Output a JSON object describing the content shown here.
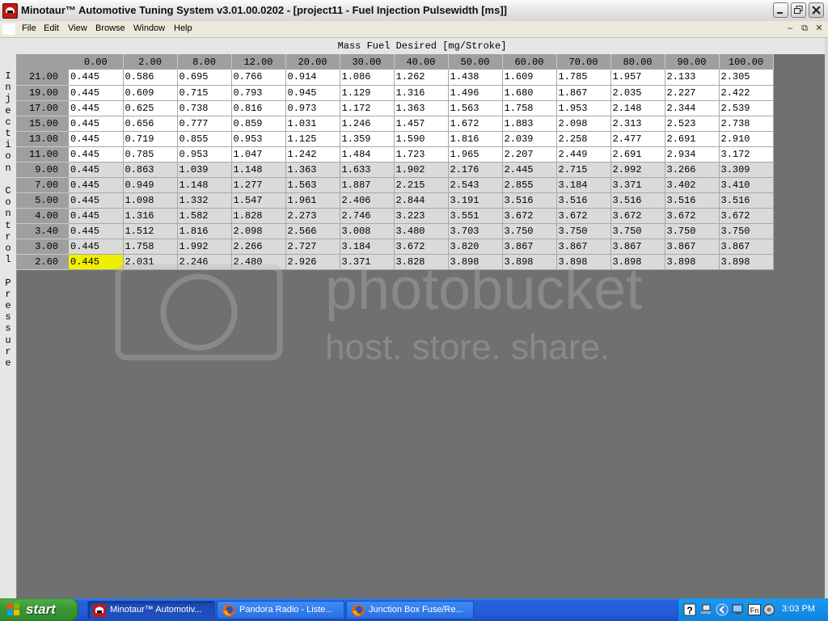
{
  "window": {
    "title": "Minotaur™ Automotive Tuning System  v3.01.00.0202 - [project11 - Fuel Injection Pulsewidth [ms]]"
  },
  "menubar": {
    "items": [
      "File",
      "Edit",
      "View",
      "Browse",
      "Window",
      "Help"
    ]
  },
  "table": {
    "column_axis_title": "Mass Fuel Desired [mg/Stroke]",
    "row_axis_title": "Injection Control Pressure",
    "columns": [
      "0.00",
      "2.00",
      "8.00",
      "12.00",
      "20.00",
      "30.00",
      "40.00",
      "50.00",
      "60.00",
      "70.00",
      "80.00",
      "90.00",
      "100.00"
    ],
    "rows": [
      {
        "label": "21.00",
        "values": [
          "0.445",
          "0.586",
          "0.695",
          "0.766",
          "0.914",
          "1.086",
          "1.262",
          "1.438",
          "1.609",
          "1.785",
          "1.957",
          "2.133",
          "2.305"
        ]
      },
      {
        "label": "19.00",
        "values": [
          "0.445",
          "0.609",
          "0.715",
          "0.793",
          "0.945",
          "1.129",
          "1.316",
          "1.496",
          "1.680",
          "1.867",
          "2.035",
          "2.227",
          "2.422"
        ]
      },
      {
        "label": "17.00",
        "values": [
          "0.445",
          "0.625",
          "0.738",
          "0.816",
          "0.973",
          "1.172",
          "1.363",
          "1.563",
          "1.758",
          "1.953",
          "2.148",
          "2.344",
          "2.539"
        ]
      },
      {
        "label": "15.00",
        "values": [
          "0.445",
          "0.656",
          "0.777",
          "0.859",
          "1.031",
          "1.246",
          "1.457",
          "1.672",
          "1.883",
          "2.098",
          "2.313",
          "2.523",
          "2.738"
        ]
      },
      {
        "label": "13.00",
        "values": [
          "0.445",
          "0.719",
          "0.855",
          "0.953",
          "1.125",
          "1.359",
          "1.590",
          "1.816",
          "2.039",
          "2.258",
          "2.477",
          "2.691",
          "2.910"
        ]
      },
      {
        "label": "11.00",
        "values": [
          "0.445",
          "0.785",
          "0.953",
          "1.047",
          "1.242",
          "1.484",
          "1.723",
          "1.965",
          "2.207",
          "2.449",
          "2.691",
          "2.934",
          "3.172"
        ]
      },
      {
        "label": "9.00",
        "values": [
          "0.445",
          "0.863",
          "1.039",
          "1.148",
          "1.363",
          "1.633",
          "1.902",
          "2.176",
          "2.445",
          "2.715",
          "2.992",
          "3.266",
          "3.309"
        ]
      },
      {
        "label": "7.00",
        "values": [
          "0.445",
          "0.949",
          "1.148",
          "1.277",
          "1.563",
          "1.887",
          "2.215",
          "2.543",
          "2.855",
          "3.184",
          "3.371",
          "3.402",
          "3.410"
        ]
      },
      {
        "label": "5.00",
        "values": [
          "0.445",
          "1.098",
          "1.332",
          "1.547",
          "1.961",
          "2.406",
          "2.844",
          "3.191",
          "3.516",
          "3.516",
          "3.516",
          "3.516",
          "3.516"
        ]
      },
      {
        "label": "4.00",
        "values": [
          "0.445",
          "1.316",
          "1.582",
          "1.828",
          "2.273",
          "2.746",
          "3.223",
          "3.551",
          "3.672",
          "3.672",
          "3.672",
          "3.672",
          "3.672"
        ]
      },
      {
        "label": "3.40",
        "values": [
          "0.445",
          "1.512",
          "1.816",
          "2.098",
          "2.566",
          "3.008",
          "3.480",
          "3.703",
          "3.750",
          "3.750",
          "3.750",
          "3.750",
          "3.750"
        ]
      },
      {
        "label": "3.00",
        "values": [
          "0.445",
          "1.758",
          "1.992",
          "2.266",
          "2.727",
          "3.184",
          "3.672",
          "3.820",
          "3.867",
          "3.867",
          "3.867",
          "3.867",
          "3.867"
        ]
      },
      {
        "label": "2.60",
        "values": [
          "0.445",
          "2.031",
          "2.246",
          "2.480",
          "2.926",
          "3.371",
          "3.828",
          "3.898",
          "3.898",
          "3.898",
          "3.898",
          "3.898",
          "3.898"
        ]
      }
    ],
    "white_row_count": 6,
    "selected_cell": {
      "row": 12,
      "col": 0
    },
    "colors": {
      "selected": "#f0ef00",
      "header": "#9f9f9f",
      "row_light": "#ffffff",
      "row_shaded": "#dadada",
      "background": "#707070"
    }
  },
  "watermark": {
    "brand": "photobucket",
    "tagline": "host. store. share."
  },
  "taskbar": {
    "start_label": "start",
    "tasks": [
      {
        "label": "Minotaur™ Automotiv...",
        "icon": "minotaur-icon",
        "active": true
      },
      {
        "label": "Pandora Radio - Liste...",
        "icon": "firefox-icon",
        "active": false
      },
      {
        "label": "Junction Box Fuse/Re...",
        "icon": "firefox-icon",
        "active": false
      }
    ],
    "clock": "3:03 PM"
  }
}
